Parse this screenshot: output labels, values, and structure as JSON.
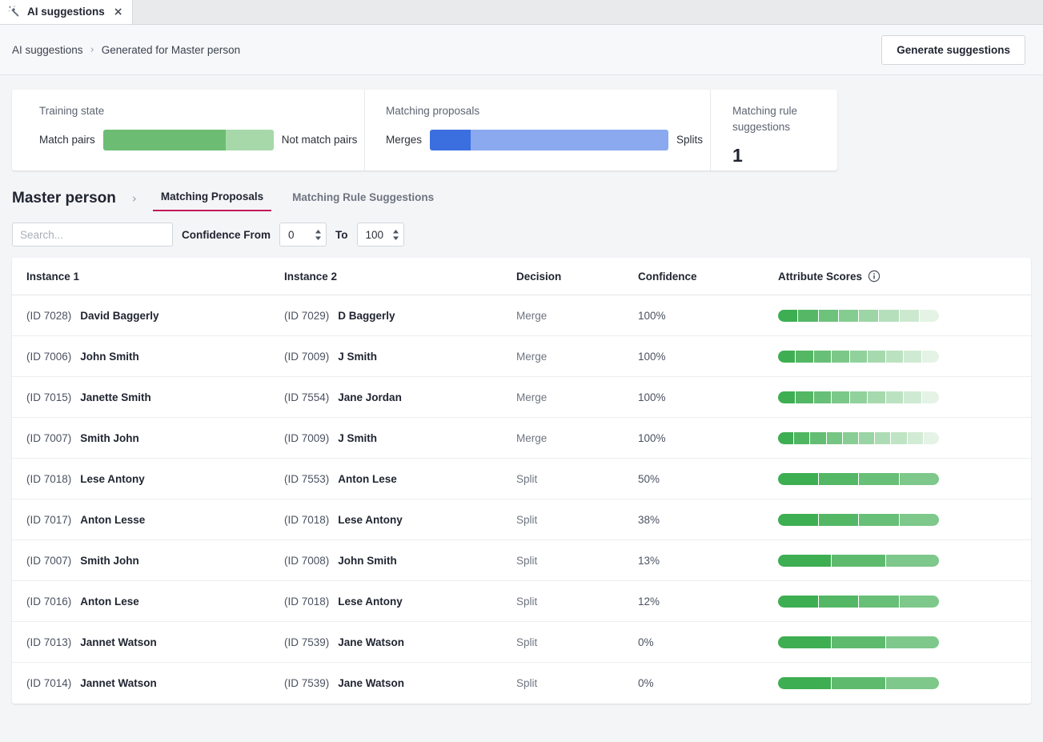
{
  "tab": {
    "title": "AI suggestions",
    "icon": "magic-wand-icon",
    "close": "×"
  },
  "breadcrumb": {
    "root": "AI suggestions",
    "separator": "›",
    "current": "Generated for Master person"
  },
  "header": {
    "generate_button": "Generate suggestions"
  },
  "summary": {
    "training": {
      "title": "Training state",
      "left_label": "Match pairs",
      "right_label": "Not match pairs",
      "match_pct": 72,
      "not_match_pct": 28,
      "match_color": "#6cbd73",
      "not_match_color": "#a7d8a9"
    },
    "proposals": {
      "title": "Matching proposals",
      "left_label": "Merges",
      "right_label": "Splits",
      "merges_pct": 17,
      "splits_pct": 83,
      "merges_color": "#3b6fe0",
      "splits_color": "#8aa9ef"
    },
    "rules": {
      "title": "Matching rule suggestions",
      "count": "1"
    }
  },
  "section": {
    "title": "Master person",
    "separator": "›",
    "tabs": [
      {
        "label": "Matching Proposals",
        "active": true
      },
      {
        "label": "Matching Rule Suggestions",
        "active": false
      }
    ]
  },
  "filters": {
    "search_placeholder": "Search...",
    "confidence_label": "Confidence From",
    "to_label": "To",
    "from_value": "0",
    "to_value": "100"
  },
  "table": {
    "columns": [
      "Instance 1",
      "Instance 2",
      "Decision",
      "Confidence",
      "Attribute Scores"
    ],
    "info_icon": "info-icon",
    "rows": [
      {
        "id1": "(ID 7028)",
        "name1": "David Baggerly",
        "id2": "(ID 7029)",
        "name2": "D Baggerly",
        "decision": "Merge",
        "confidence": "100%",
        "segments": 8
      },
      {
        "id1": "(ID 7006)",
        "name1": "John Smith",
        "id2": "(ID 7009)",
        "name2": "J Smith",
        "decision": "Merge",
        "confidence": "100%",
        "segments": 9
      },
      {
        "id1": "(ID 7015)",
        "name1": "Janette Smith",
        "id2": "(ID 7554)",
        "name2": "Jane Jordan",
        "decision": "Merge",
        "confidence": "100%",
        "segments": 9
      },
      {
        "id1": "(ID 7007)",
        "name1": "Smith John",
        "id2": "(ID 7009)",
        "name2": "J Smith",
        "decision": "Merge",
        "confidence": "100%",
        "segments": 10
      },
      {
        "id1": "(ID 7018)",
        "name1": "Lese Antony",
        "id2": "(ID 7553)",
        "name2": "Anton Lese",
        "decision": "Split",
        "confidence": "50%",
        "segments": 4
      },
      {
        "id1": "(ID 7017)",
        "name1": "Anton Lesse",
        "id2": "(ID 7018)",
        "name2": "Lese Antony",
        "decision": "Split",
        "confidence": "38%",
        "segments": 4
      },
      {
        "id1": "(ID 7007)",
        "name1": "Smith John",
        "id2": "(ID 7008)",
        "name2": "John Smith",
        "decision": "Split",
        "confidence": "13%",
        "segments": 3
      },
      {
        "id1": "(ID 7016)",
        "name1": "Anton Lese",
        "id2": "(ID 7018)",
        "name2": "Lese Antony",
        "decision": "Split",
        "confidence": "12%",
        "segments": 4
      },
      {
        "id1": "(ID 7013)",
        "name1": "Jannet Watson",
        "id2": "(ID 7539)",
        "name2": "Jane Watson",
        "decision": "Split",
        "confidence": "0%",
        "segments": 3
      },
      {
        "id1": "(ID 7014)",
        "name1": "Jannet Watson",
        "id2": "(ID 7539)",
        "name2": "Jane Watson",
        "decision": "Split",
        "confidence": "0%",
        "segments": 3
      }
    ],
    "score_gradient": {
      "start": "#3eae52",
      "end": "#e4f3e5"
    }
  }
}
